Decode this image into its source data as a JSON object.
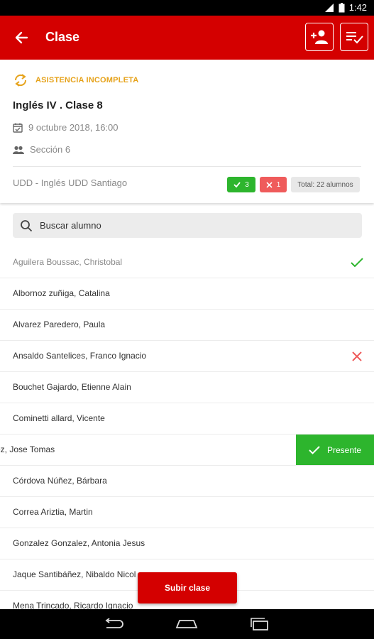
{
  "status_bar": {
    "time": "1:42"
  },
  "app_bar": {
    "title": "Clase"
  },
  "class_info": {
    "status": "ASISTENCIA INCOMPLETA",
    "title": "Inglés IV . Clase 8",
    "datetime": "9 octubre 2018, 16:00",
    "section": "Sección 6",
    "course": "UDD - Inglés UDD Santiago",
    "present_count": "3",
    "absent_count": "1",
    "total": "Total: 22 alumnos"
  },
  "search": {
    "placeholder": "Buscar alumno"
  },
  "students": [
    {
      "name": "Aguilera Boussac, Christobal",
      "mark": "present"
    },
    {
      "name": "Albornoz zuñiga, Catalina",
      "mark": ""
    },
    {
      "name": "Alvarez Paredero, Paula",
      "mark": ""
    },
    {
      "name": "Ansaldo Santelices, Franco Ignacio",
      "mark": "absent"
    },
    {
      "name": "Bouchet Gajardo, Etienne Alain",
      "mark": ""
    },
    {
      "name": "Cominetti allard, Vicente",
      "mark": ""
    },
    {
      "name": "ez, Jose Tomas",
      "mark": "swipe"
    },
    {
      "name": "Córdova Núñez, Bárbara",
      "mark": ""
    },
    {
      "name": "Correa Ariztia, Martin",
      "mark": ""
    },
    {
      "name": "Gonzalez Gonzalez, Antonia Jesus",
      "mark": ""
    },
    {
      "name": "Jaque Santibáñez, Nibaldo Nicol",
      "mark": ""
    },
    {
      "name": "Mena Trincado, Ricardo Ignacio",
      "mark": ""
    }
  ],
  "swipe_action": {
    "label": "Presente"
  },
  "fab": {
    "label": "Subir clase"
  },
  "colors": {
    "brand": "#d40000",
    "present": "#2db52d",
    "absent": "#ef5b5b",
    "warning": "#e6a21a"
  }
}
